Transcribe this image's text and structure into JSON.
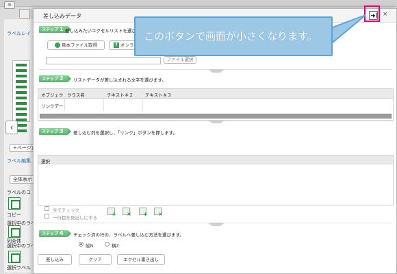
{
  "app": {
    "menu_icon": "hamburger-icon",
    "side_labels": [
      "ラベルレイ",
      "ラベル編集",
      "ラベルのコ",
      "選択中のラベ",
      "選択中のラベ"
    ],
    "side_buttons": [
      "ページ追",
      "全体表示",
      "コピー",
      "列全体",
      "選択ラベル"
    ]
  },
  "dialog": {
    "title": "差し込みデータ",
    "close_label": "×",
    "steps": [
      {
        "badge": "ステップ",
        "num": "1",
        "text": "差し込みたいエクセルリストを選びます。"
      },
      {
        "badge": "ステップ",
        "num": "2",
        "text": "リストデータが差し込まれる文字を選びます。"
      },
      {
        "badge": "ステップ",
        "num": "3",
        "text": "差し込む列を選択し、「リンク」ボタンを押します。"
      },
      {
        "badge": "ステップ",
        "num": "4",
        "text": "チェック済の行の、ラベルへ差し込む方法を選びます。"
      }
    ],
    "step1": {
      "sample_button": "見本ファイル取得",
      "online_button": "オンライ",
      "file_button": "ファイル選択",
      "file_value": ""
    },
    "table": {
      "headers": [
        "オブジェク",
        "クラス名",
        "テキスト＃２",
        "テキスト＃３"
      ],
      "rows": [
        [
          "リンクデー",
          "",
          "",
          ""
        ]
      ]
    },
    "selection": {
      "header": "選択",
      "check_all": "全てチェック",
      "first_row_header": "一行目を見出しにする"
    },
    "step4": {
      "radio_options": [
        "縦N",
        "横Z"
      ],
      "selected": "縦N"
    },
    "actions": [
      "差し込み",
      "クリア",
      "エクセル書き出し"
    ]
  },
  "callout": {
    "text": "このボタンで画面が小さくなります。"
  },
  "colors": {
    "accent_green": "#3aa556",
    "highlight": "#e4007f",
    "callout_fill": "#9cc8e6"
  }
}
